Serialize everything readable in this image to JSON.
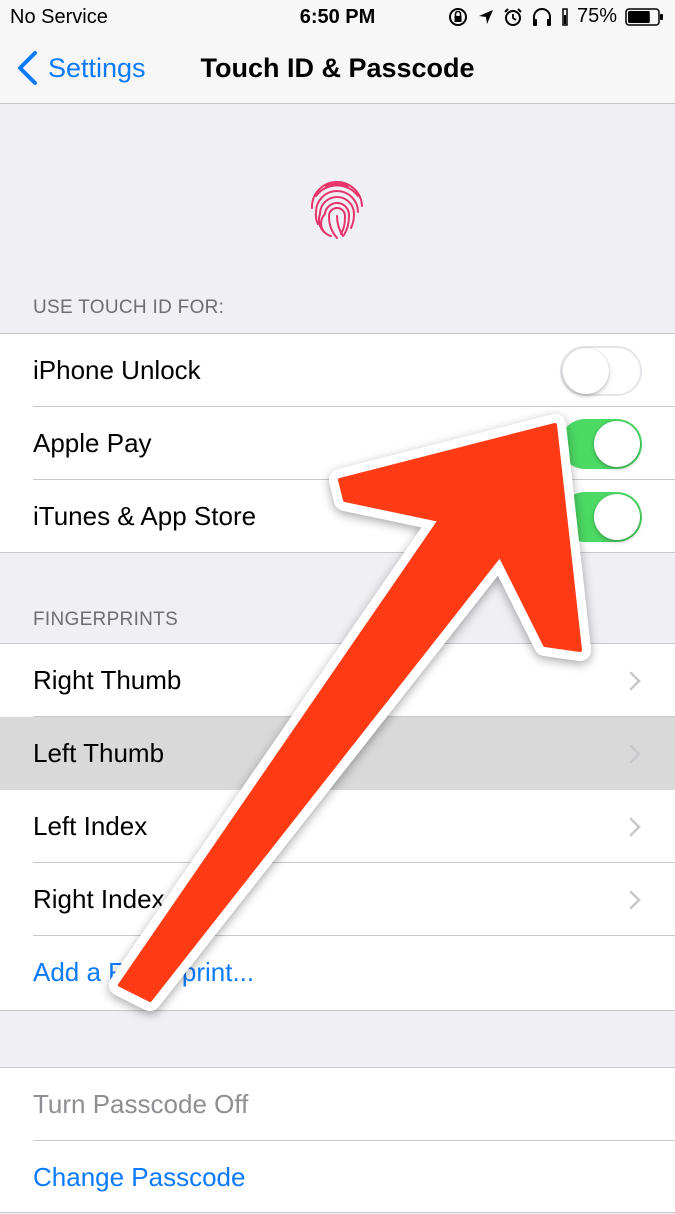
{
  "status": {
    "carrier": "No Service",
    "time": "6:50 PM",
    "battery": "75%",
    "battery_level": 0.75,
    "icons": [
      "orientation-lock-icon",
      "location-arrow-icon",
      "alarm-icon",
      "headphones-icon",
      "battery-icon"
    ]
  },
  "nav": {
    "back_label": "Settings",
    "title": "Touch ID & Passcode"
  },
  "touch_id": {
    "header": "USE TOUCH ID FOR:",
    "items": [
      {
        "label": "iPhone Unlock",
        "on": false
      },
      {
        "label": "Apple Pay",
        "on": true
      },
      {
        "label": "iTunes & App Store",
        "on": true
      }
    ]
  },
  "fingerprints": {
    "header": "FINGERPRINTS",
    "items": [
      {
        "label": "Right Thumb"
      },
      {
        "label": "Left Thumb",
        "selected": true
      },
      {
        "label": "Left Index"
      },
      {
        "label": "Right Index"
      }
    ],
    "add_label": "Add a Fingerprint..."
  },
  "passcode": {
    "turn_off_label": "Turn Passcode Off",
    "change_label": "Change Passcode"
  },
  "colors": {
    "accent": "#0a7afe",
    "toggle_on": "#4cd964",
    "arrow": "#ff3b12",
    "fingerprint": "#e8336b"
  }
}
